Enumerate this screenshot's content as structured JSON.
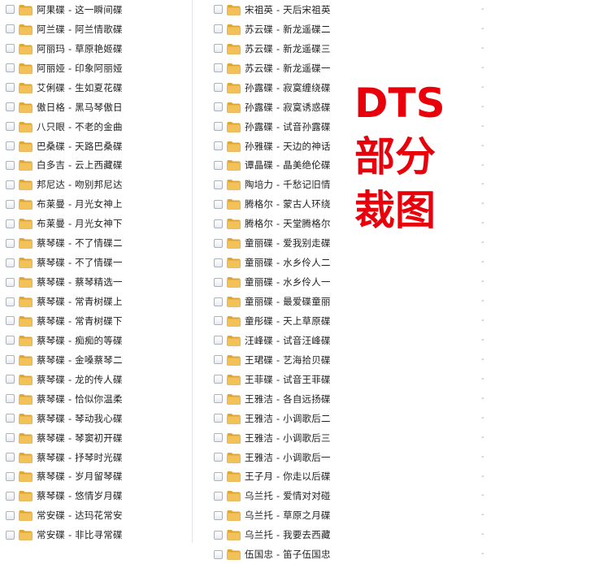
{
  "left_files": [
    "阿果碟 - 这一瞬间碟",
    "阿兰碟 - 阿兰情歌碟",
    "阿丽玛 - 草原艳姬碟",
    "阿丽娅 - 印象阿丽娅",
    "艾俐碟 - 生如夏花碟",
    "傲日格 - 黑马琴傲日",
    "八只眼 - 不老的金曲",
    "巴桑碟 - 天路巴桑碟",
    "白多吉 - 云上西藏碟",
    "邦尼达 - 吻别邦尼达",
    "布莱曼 - 月光女神上",
    "布莱曼 - 月光女神下",
    "蔡琴碟 - 不了情碟二",
    "蔡琴碟 - 不了情碟一",
    "蔡琴碟 - 蔡琴精选一",
    "蔡琴碟 - 常青树碟上",
    "蔡琴碟 - 常青树碟下",
    "蔡琴碟 - 痴痴的等碟",
    "蔡琴碟 - 金嗓蔡琴二",
    "蔡琴碟 - 龙的传人碟",
    "蔡琴碟 - 恰似你温柔",
    "蔡琴碟 - 琴动我心碟",
    "蔡琴碟 - 琴窦初开碟",
    "蔡琴碟 - 抒琴时光碟",
    "蔡琴碟 - 岁月留琴碟",
    "蔡琴碟 - 悠情岁月碟",
    "常安碟 - 达玛花常安",
    "常安碟 - 非比寻常碟"
  ],
  "right_files": [
    "宋祖英 - 天后宋祖英",
    "苏云碟 - 新龙遥碟二",
    "苏云碟 - 新龙遥碟三",
    "苏云碟 - 新龙遥碟一",
    "孙露碟 - 寂寞缠绕碟",
    "孙露碟 - 寂寞诱惑碟",
    "孙露碟 - 试音孙露碟",
    "孙雅碟 - 天边的神话",
    "谭晶碟 - 晶美绝伦碟",
    "陶培力 - 千愁记旧情",
    "腾格尔 - 蒙古人环绕",
    "腾格尔 - 天堂腾格尔",
    "童丽碟 - 爱我别走碟",
    "童丽碟 - 水乡伶人二",
    "童丽碟 - 水乡伶人一",
    "童丽碟 - 最爱碟童丽",
    "童彤碟 - 天上草原碟",
    "汪峰碟 - 试音汪峰碟",
    "王珺碟 - 艺海拾贝碟",
    "王菲碟 - 试音王菲碟",
    "王雅洁 - 各自远扬碟",
    "王雅洁 - 小调歌后二",
    "王雅洁 - 小调歌后三",
    "王雅洁 - 小调歌后一",
    "王子月 - 你走以后碟",
    "乌兰托 - 爱情对对碰",
    "乌兰托 - 草原之月碟",
    "乌兰托 - 我要去西藏",
    "伍国忠 - 笛子伍国忠"
  ],
  "size_placeholder": "-",
  "overlay": {
    "line1": "DTS",
    "line2": "部分",
    "line3": "裁图"
  },
  "colors": {
    "overlay_text": "#e8000b",
    "folder": "#f2c15a",
    "checkbox_border": "#a9b1bd"
  },
  "icons": {
    "row_icon": "folder-icon",
    "row_control": "checkbox"
  }
}
